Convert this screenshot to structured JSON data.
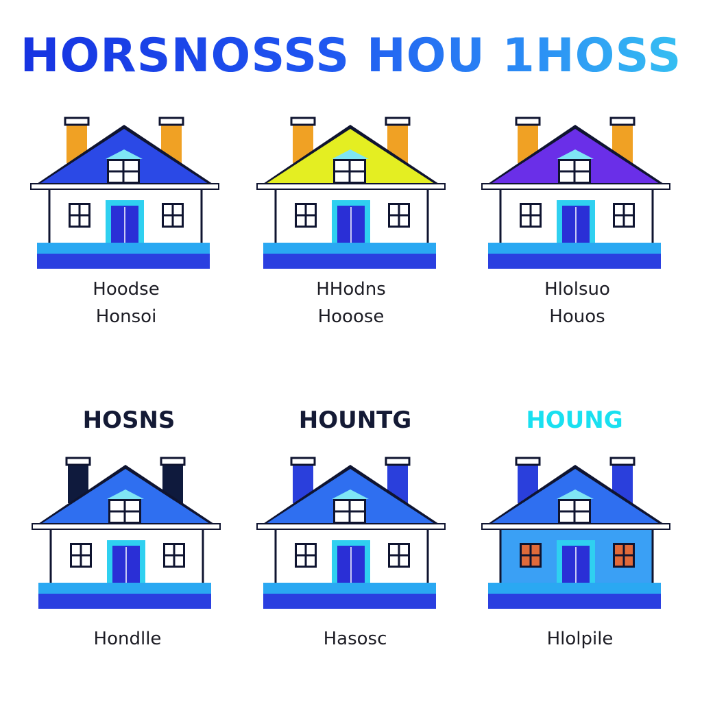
{
  "title": "HORSNOSSS HOU 1HOSS",
  "houses": [
    {
      "roof_color": "#2b49e6",
      "chimney_color": "#f0a124",
      "door_color": "#2a2fd6",
      "wall_color": "#ffffff",
      "window_color": "#ffffff",
      "caption_lines": [
        "Hoodse",
        "Honsoi"
      ]
    },
    {
      "roof_color": "#e4ee22",
      "chimney_color": "#f0a124",
      "door_color": "#2a2fd6",
      "wall_color": "#ffffff",
      "window_color": "#ffffff",
      "caption_lines": [
        "HHodns",
        "Hooose"
      ]
    },
    {
      "roof_color": "#6a2fe8",
      "chimney_color": "#f0a124",
      "door_color": "#2a2fd6",
      "wall_color": "#ffffff",
      "window_color": "#ffffff",
      "caption_lines": [
        "Hlolsuo",
        "Houos"
      ]
    },
    {
      "label": "HOSNS",
      "label_color": "#141a35",
      "roof_color": "#2f6ff0",
      "chimney_color": "#0f1a3d",
      "door_color": "#2a2fd6",
      "wall_color": "#ffffff",
      "window_color": "#ffffff",
      "caption_lines": [
        "Hondlle"
      ]
    },
    {
      "label": "HOUNTG",
      "label_color": "#141a35",
      "roof_color": "#2f6ff0",
      "chimney_color": "#2a3fdc",
      "door_color": "#2a2fd6",
      "wall_color": "#ffffff",
      "window_color": "#ffffff",
      "caption_lines": [
        "Hasosc"
      ]
    },
    {
      "label": "HOUNG",
      "label_color": "#19e0f0",
      "roof_color": "#2f6ff0",
      "chimney_color": "#2a3fdc",
      "door_color": "#2a2fd6",
      "wall_color": "#3aa0f5",
      "window_color": "#e06a3a",
      "caption_lines": [
        "Hlolpile"
      ]
    }
  ]
}
